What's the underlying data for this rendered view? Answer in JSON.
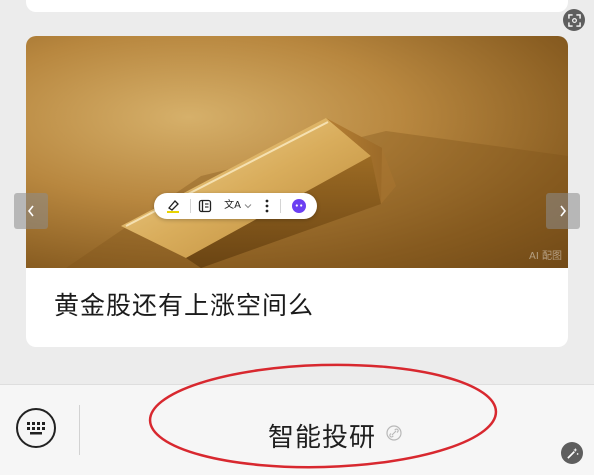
{
  "card": {
    "title": "黄金股还有上涨空间么",
    "watermark": "AI 配图"
  },
  "toolbar": {
    "icons": [
      "highlighter-icon",
      "notes-icon",
      "translate-icon",
      "chevron-down-icon",
      "more-vertical-icon",
      "assistant-icon"
    ],
    "translate_glyph": "文A"
  },
  "carousel": {
    "prev_icon": "chevron-left-icon",
    "next_icon": "chevron-right-icon"
  },
  "bottom_bar": {
    "main_label": "智能投研",
    "keyboard_icon": "keyboard-icon",
    "link_icon": "link-icon"
  },
  "corner_icons": [
    "expand-icon",
    "magic-wand-icon"
  ],
  "annotation": {
    "shape": "ellipse",
    "color": "#d8282f"
  },
  "colors": {
    "accent_purple": "#6b3ff2",
    "highlight_yellow": "#e8d400",
    "page_bg": "#ececec"
  }
}
